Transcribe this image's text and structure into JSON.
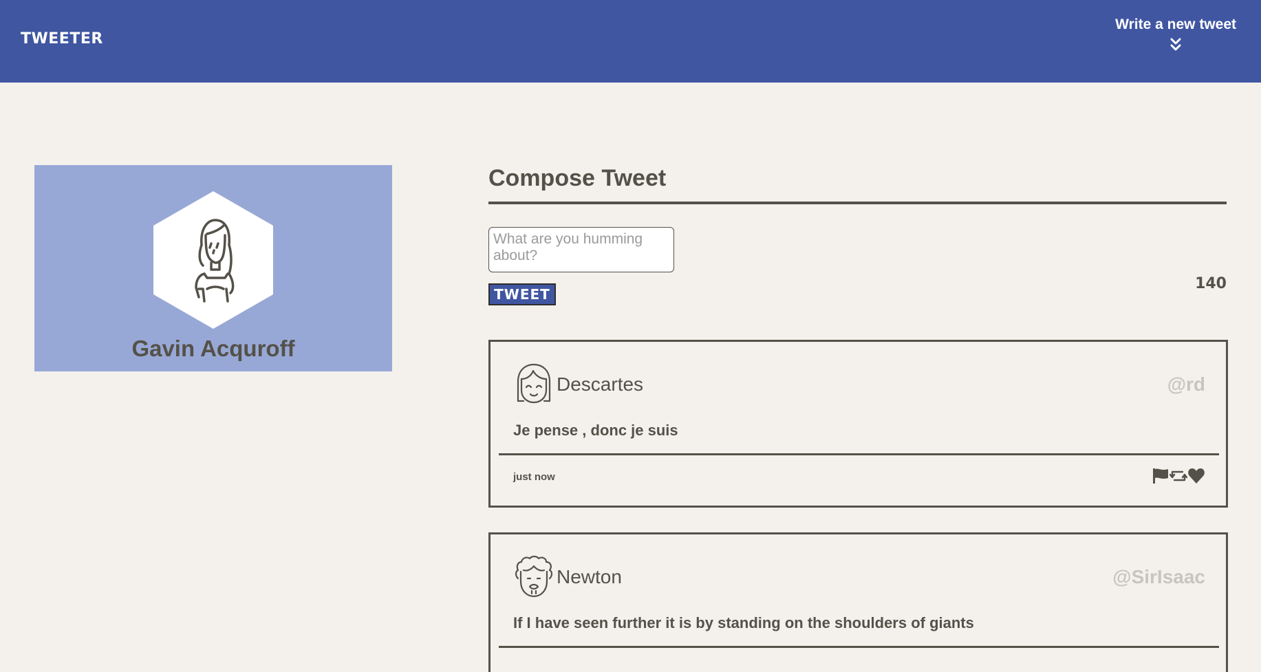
{
  "nav": {
    "brand": "TWEETER",
    "compose_label": "Write a new tweet",
    "compose_icon": "double-chevron-down-icon",
    "background": "#4056a1"
  },
  "profile": {
    "name": "Gavin Acquroff",
    "avatar_icon": "woman-avatar-icon",
    "card_color": "#98a8d6"
  },
  "compose": {
    "title": "Compose Tweet",
    "placeholder": "What are you humming about?",
    "button_label": "TWEET",
    "counter": "140"
  },
  "tweets": [
    {
      "author": "Descartes",
      "handle": "@rd",
      "content": "Je pense , donc je suis",
      "time": "just now",
      "avatar_icon": "girl-avatar-icon",
      "actions": [
        "flag-icon",
        "retweet-icon",
        "heart-icon"
      ]
    },
    {
      "author": "Newton",
      "handle": "@SirIsaac",
      "content": "If I have seen further it is by standing on the shoulders of giants",
      "avatar_icon": "curly-hair-avatar-icon"
    }
  ]
}
